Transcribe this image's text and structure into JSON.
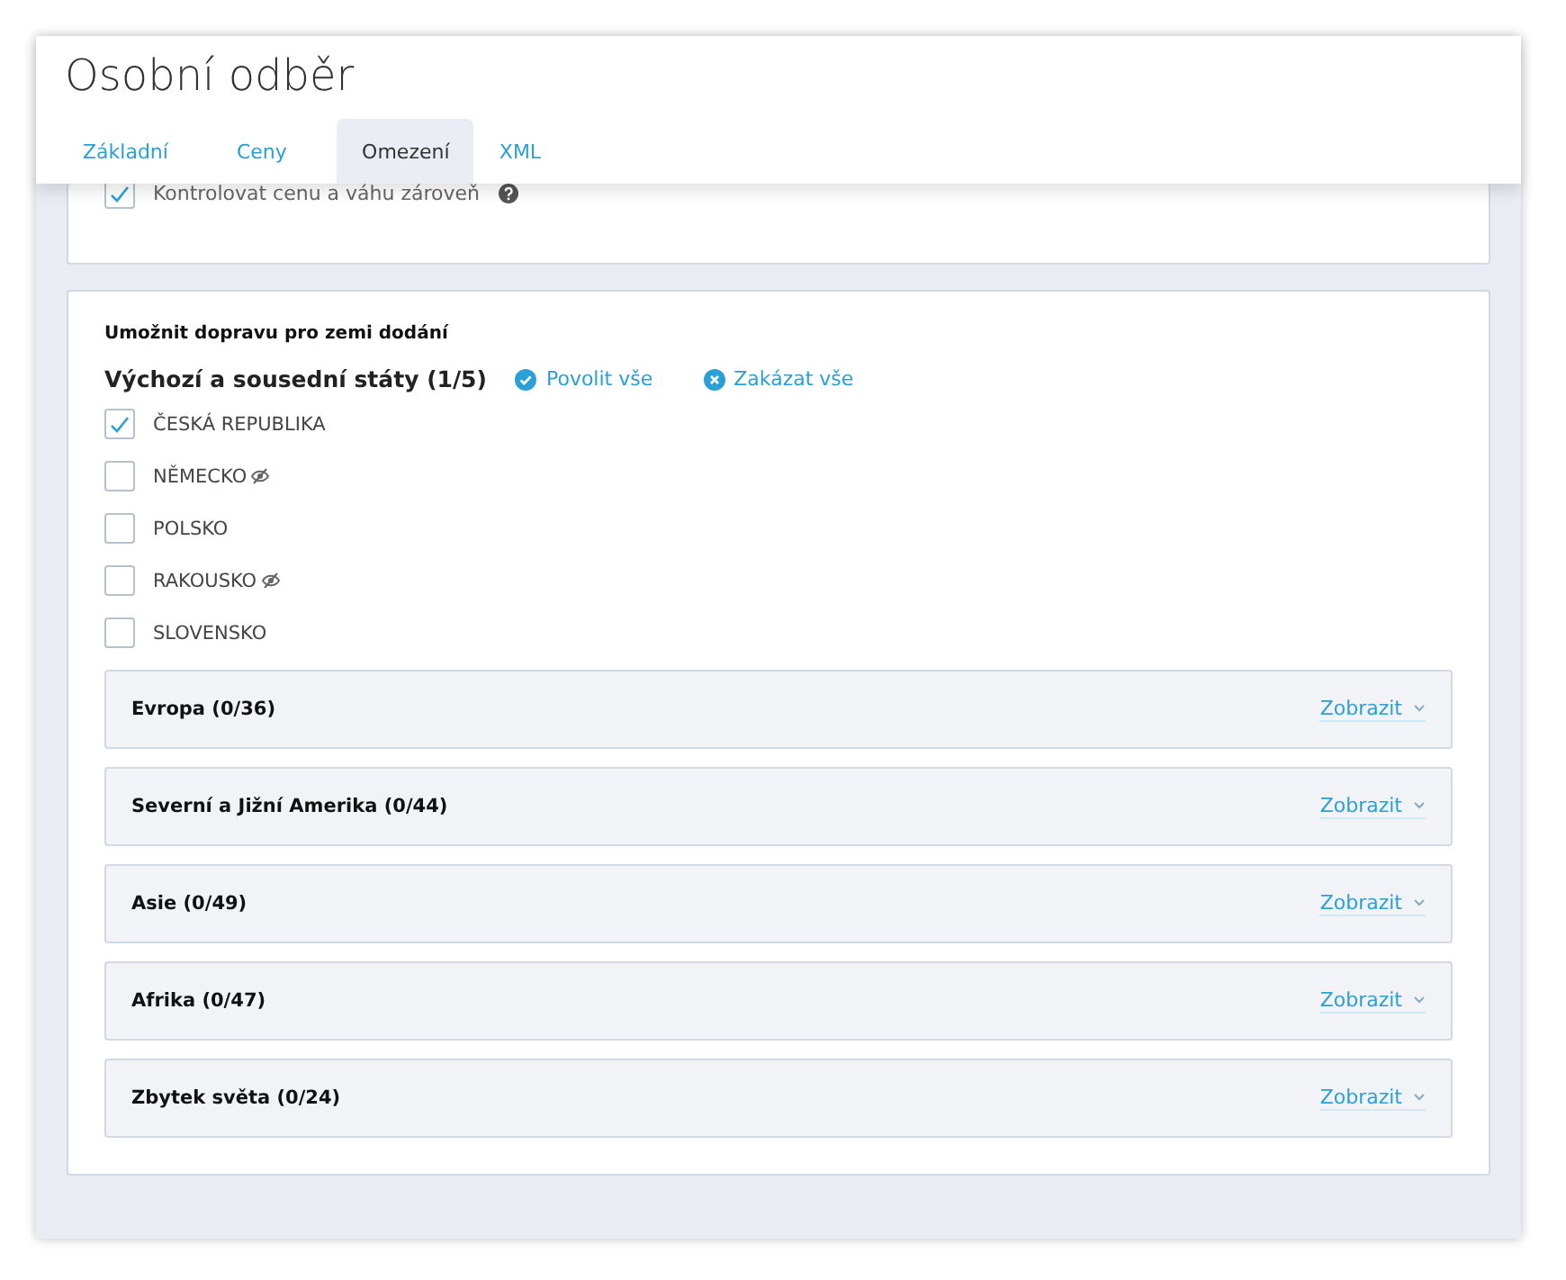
{
  "window": {
    "title": "Osobní odběr"
  },
  "tabs": [
    {
      "label": "Základní",
      "selected": false
    },
    {
      "label": "Ceny",
      "selected": false
    },
    {
      "label": "Omezení",
      "selected": true
    },
    {
      "label": "XML",
      "selected": false
    }
  ],
  "top_option": {
    "label": "Kontrolovat cenu a váhu zároveň",
    "checked": true
  },
  "section": {
    "title": "Umožnit dopravu pro zemi dodání",
    "group_title": "Výchozí a sousední státy (1/5)",
    "enable_all": "Povolit vše",
    "disable_all": "Zakázat vše",
    "countries": [
      {
        "name": "ČESKÁ REPUBLIKA",
        "checked": true,
        "hidden_mark": false
      },
      {
        "name": "NĚMECKO",
        "checked": false,
        "hidden_mark": true
      },
      {
        "name": "POLSKO",
        "checked": false,
        "hidden_mark": false
      },
      {
        "name": "RAKOUSKO",
        "checked": false,
        "hidden_mark": true
      },
      {
        "name": "SLOVENSKO",
        "checked": false,
        "hidden_mark": false
      }
    ],
    "regions": [
      {
        "title": "Evropa (0/36)",
        "action": "Zobrazit"
      },
      {
        "title": "Severní a Jižní Amerika (0/44)",
        "action": "Zobrazit"
      },
      {
        "title": "Asie (0/49)",
        "action": "Zobrazit"
      },
      {
        "title": "Afrika (0/47)",
        "action": "Zobrazit"
      },
      {
        "title": "Zbytek světa (0/24)",
        "action": "Zobrazit"
      }
    ]
  }
}
